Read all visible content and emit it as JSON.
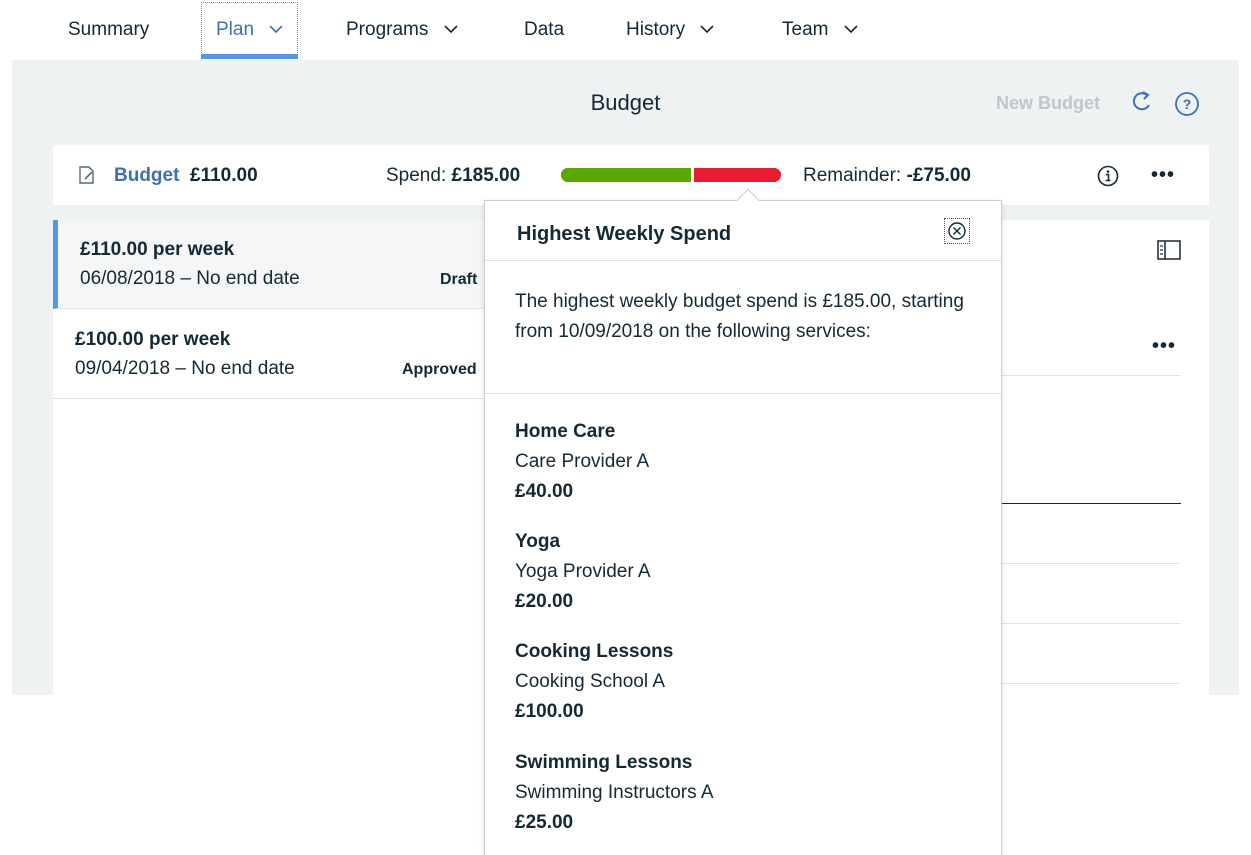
{
  "tabs": [
    {
      "label": "Summary",
      "has_dropdown": false,
      "active": false
    },
    {
      "label": "Plan",
      "has_dropdown": true,
      "active": true
    },
    {
      "label": "Programs",
      "has_dropdown": true,
      "active": false
    },
    {
      "label": "Data",
      "has_dropdown": false,
      "active": false
    },
    {
      "label": "History",
      "has_dropdown": true,
      "active": false
    },
    {
      "label": "Team",
      "has_dropdown": true,
      "active": false
    }
  ],
  "header": {
    "title": "Budget",
    "new_budget_label": "New Budget"
  },
  "summary": {
    "budget_label": "Budget",
    "budget_amount": "£110.00",
    "spend_label": "Spend:",
    "spend_amount": "£185.00",
    "remainder_label": "Remainder:",
    "remainder_amount": "-£75.00",
    "spend_progress": {
      "budget_fraction": 0.595,
      "over_budget_fraction": 0.405,
      "colors": {
        "within": "#5aa700",
        "over": "#e71d32"
      }
    }
  },
  "budget_list": [
    {
      "title": "£110.00 per week",
      "date": "06/08/2018 – No end date",
      "status": "Draft",
      "selected": true
    },
    {
      "title": "£100.00 per week",
      "date": "09/04/2018 – No end date",
      "status": "Approved",
      "selected": false
    }
  ],
  "popover": {
    "title": "Highest Weekly Spend",
    "description": "The highest weekly budget spend is £185.00, starting from 10/09/2018 on the following services:",
    "services": [
      {
        "name": "Home Care",
        "provider": "Care Provider A",
        "amount": "£40.00"
      },
      {
        "name": "Yoga",
        "provider": "Yoga Provider A",
        "amount": "£20.00"
      },
      {
        "name": "Cooking Lessons",
        "provider": "Cooking School A",
        "amount": "£100.00"
      },
      {
        "name": "Swimming Lessons",
        "provider": "Swimming Instructors A",
        "amount": "£25.00"
      }
    ]
  },
  "colors": {
    "accent": "#3d70b2",
    "tab_indicator": "#5596e6",
    "panel_bg": "#eef2f3",
    "over_budget": "#e71d32",
    "within_budget": "#5aa700"
  },
  "icons": {
    "refresh": "refresh-icon",
    "help": "help-icon",
    "edit": "edit-icon",
    "info": "info-icon",
    "more": "more-icon",
    "panel": "side-panel-icon",
    "close": "close-icon",
    "chevron": "chevron-down-icon"
  }
}
